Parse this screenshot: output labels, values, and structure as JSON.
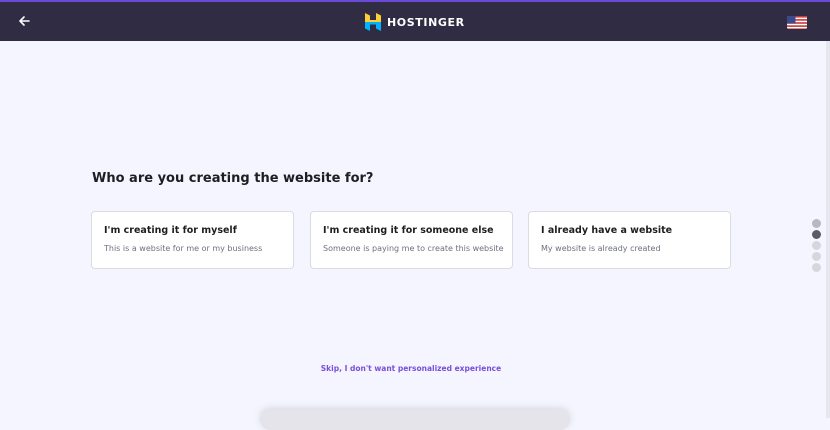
{
  "header": {
    "brand": "HOSTINGER",
    "back_icon": "arrow-left-icon",
    "language_icon": "us-flag-icon"
  },
  "colors": {
    "header_bg": "#2f2c44",
    "page_bg": "#f4f5ff",
    "accent": "#7d4dd9",
    "logo_yellow": "#ffcd35",
    "logo_blue": "#00b3ff"
  },
  "main": {
    "question": "Who are you creating the website for?",
    "options": [
      {
        "title": "I'm creating it for myself",
        "description": "This is a website for me or my business"
      },
      {
        "title": "I'm creating it for someone else",
        "description": "Someone is paying me to create this website"
      },
      {
        "title": "I already have a website",
        "description": "My website is already created"
      }
    ],
    "skip_label": "Skip, I don't want personalized experience"
  },
  "progress": {
    "total_steps": 5,
    "current_step": 2
  }
}
